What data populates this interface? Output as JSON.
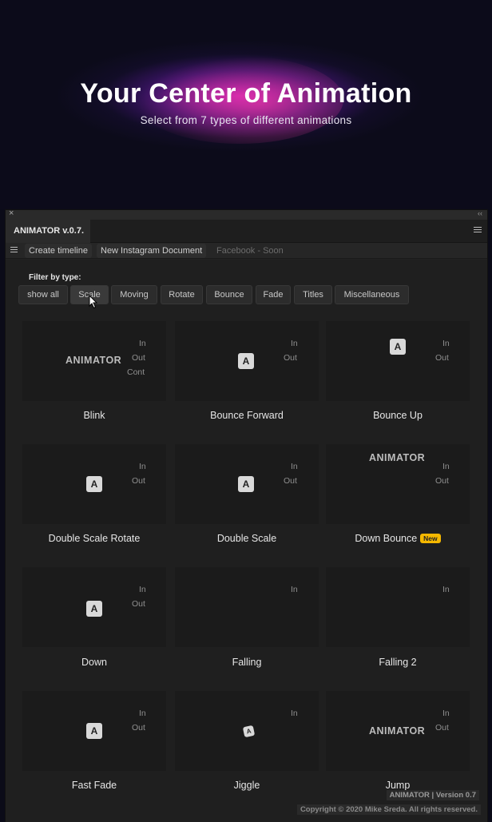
{
  "hero": {
    "title": "Your Center of Animation",
    "subtitle": "Select from 7 types of different animations"
  },
  "panel": {
    "tab_title": "ANIMATOR v.0.7.",
    "toolbar": {
      "create_timeline": "Create timeline",
      "new_instagram": "New Instagram Document",
      "facebook": "Facebook - Soon"
    },
    "filter_label": "Filter by type:",
    "filters": [
      "show all",
      "Scale",
      "Moving",
      "Rotate",
      "Bounce",
      "Fade",
      "Titles",
      "Miscellaneous"
    ],
    "active_filter": "Scale"
  },
  "cards": [
    {
      "label": "Blink",
      "preview": "ANIMATOR",
      "options": [
        "In",
        "Out",
        "Cont"
      ]
    },
    {
      "label": "Bounce Forward",
      "preview": "A",
      "options": [
        "In",
        "Out"
      ]
    },
    {
      "label": "Bounce Up",
      "preview": "A",
      "options": [
        "In",
        "Out"
      ]
    },
    {
      "label": "Double Scale Rotate",
      "preview": "A",
      "options": [
        "In",
        "Out"
      ]
    },
    {
      "label": "Double Scale",
      "preview": "A",
      "options": [
        "In",
        "Out"
      ]
    },
    {
      "label": "Down Bounce",
      "preview": "ANIMATOR",
      "options": [
        "In",
        "Out"
      ],
      "badge": "New"
    },
    {
      "label": "Down",
      "preview": "A",
      "options": [
        "In",
        "Out"
      ]
    },
    {
      "label": "Falling",
      "preview": "",
      "options": [
        "In"
      ]
    },
    {
      "label": "Falling 2",
      "preview": "",
      "options": [
        "In"
      ]
    },
    {
      "label": "Fast Fade",
      "preview": "A",
      "options": [
        "In",
        "Out"
      ]
    },
    {
      "label": "Jiggle",
      "preview": "A",
      "options": [
        "In"
      ]
    },
    {
      "label": "Jump",
      "preview": "ANIMATOR",
      "options": [
        "In",
        "Out"
      ]
    }
  ],
  "footer": {
    "version": "ANIMATOR | Version 0.7",
    "copyright": "Copyright © 2020 Mike Sreda. All rights reserved."
  },
  "colors": {
    "accent_badge": "#f5b800",
    "panel_bg": "#222222",
    "hero_glow": "#dc28c8"
  },
  "icons": [
    "close-icon",
    "collapse-icon",
    "panel-menu-icon",
    "hamburger-icon",
    "cursor-icon"
  ]
}
